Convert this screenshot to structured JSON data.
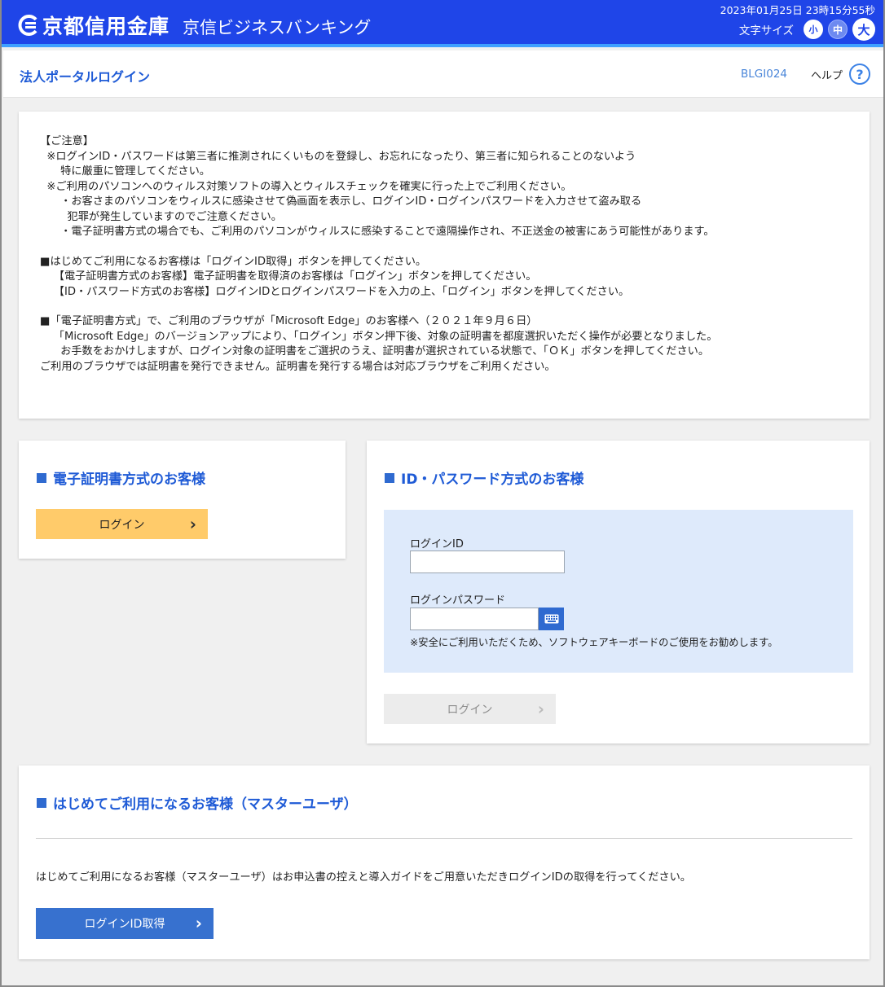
{
  "header": {
    "logo_text": "京都信用金庫",
    "app_name": "京信ビジネスバンキング",
    "clock": "2023年01月25日 23時15分55秒",
    "font_size_label": "文字サイズ",
    "font_small": "小",
    "font_medium": "中",
    "font_large": "大",
    "colors": {
      "bar": "#1f45e8",
      "accent_line": "#3fa0ff"
    }
  },
  "titlebar": {
    "title": "法人ポータルログイン",
    "screen_id": "BLGI024",
    "help_label": "ヘルプ",
    "help_icon": "?"
  },
  "notice": {
    "lines": [
      "【ご注意】",
      "  ※ログインID・パスワードは第三者に推測されにくいものを登録し、お忘れになったり、第三者に知られることのないよう",
      "      特に厳重に管理してください。",
      "  ※ご利用のパソコンへのウィルス対策ソフトの導入とウィルスチェックを確実に行った上でご利用ください。",
      "      ・お客さまのパソコンをウィルスに感染させて偽画面を表示し、ログインID・ログインパスワードを入力させて盗み取る",
      "        犯罪が発生していますのでご注意ください。",
      "      ・電子証明書方式の場合でも、ご利用のパソコンがウィルスに感染することで遠隔操作され、不正送金の被害にあう可能性があります。",
      "",
      "■はじめてご利用になるお客様は「ログインID取得」ボタンを押してください。",
      "    【電子証明書方式のお客様】電子証明書を取得済のお客様は「ログイン」ボタンを押してください。",
      "    【ID・パスワード方式のお客様】ログインIDとログインパスワードを入力の上、「ログイン」ボタンを押してください。",
      "",
      "■「電子証明書方式」で、ご利用のブラウザが「Microsoft Edge」のお客様へ（２０２１年９月６日）",
      "    「Microsoft Edge」のバージョンアップにより、「ログイン」ボタン押下後、対象の証明書を都度選択いただく操作が必要となりました。",
      "      お手数をおかけしますが、ログイン対象の証明書をご選択のうえ、証明書が選択されている状態で、「ＯＫ」ボタンを押してください。",
      "ご利用のブラウザでは証明書を発行できません。証明書を発行する場合は対応ブラウザをご利用ください。"
    ]
  },
  "cert_section": {
    "title": "電子証明書方式のお客様",
    "login_label": "ログイン",
    "button_color": "#ffcb6a"
  },
  "idpw_section": {
    "title": "ID・パスワード方式のお客様",
    "login_id_label": "ログインID",
    "login_id_value": "",
    "password_label": "ログインパスワード",
    "password_value": "",
    "keyboard_note": "※安全にご利用いただくため、ソフトウェアキーボードのご使用をお勧めします。",
    "login_label": "ログイン"
  },
  "master_section": {
    "title": "はじめてご利用になるお客様（マスターユーザ）",
    "description": "はじめてご利用になるお客様（マスターユーザ）はお申込書の控えと導入ガイドをご用意いただきログインIDの取得を行ってください。",
    "button_label": "ログインID取得",
    "button_color": "#3771cf"
  }
}
